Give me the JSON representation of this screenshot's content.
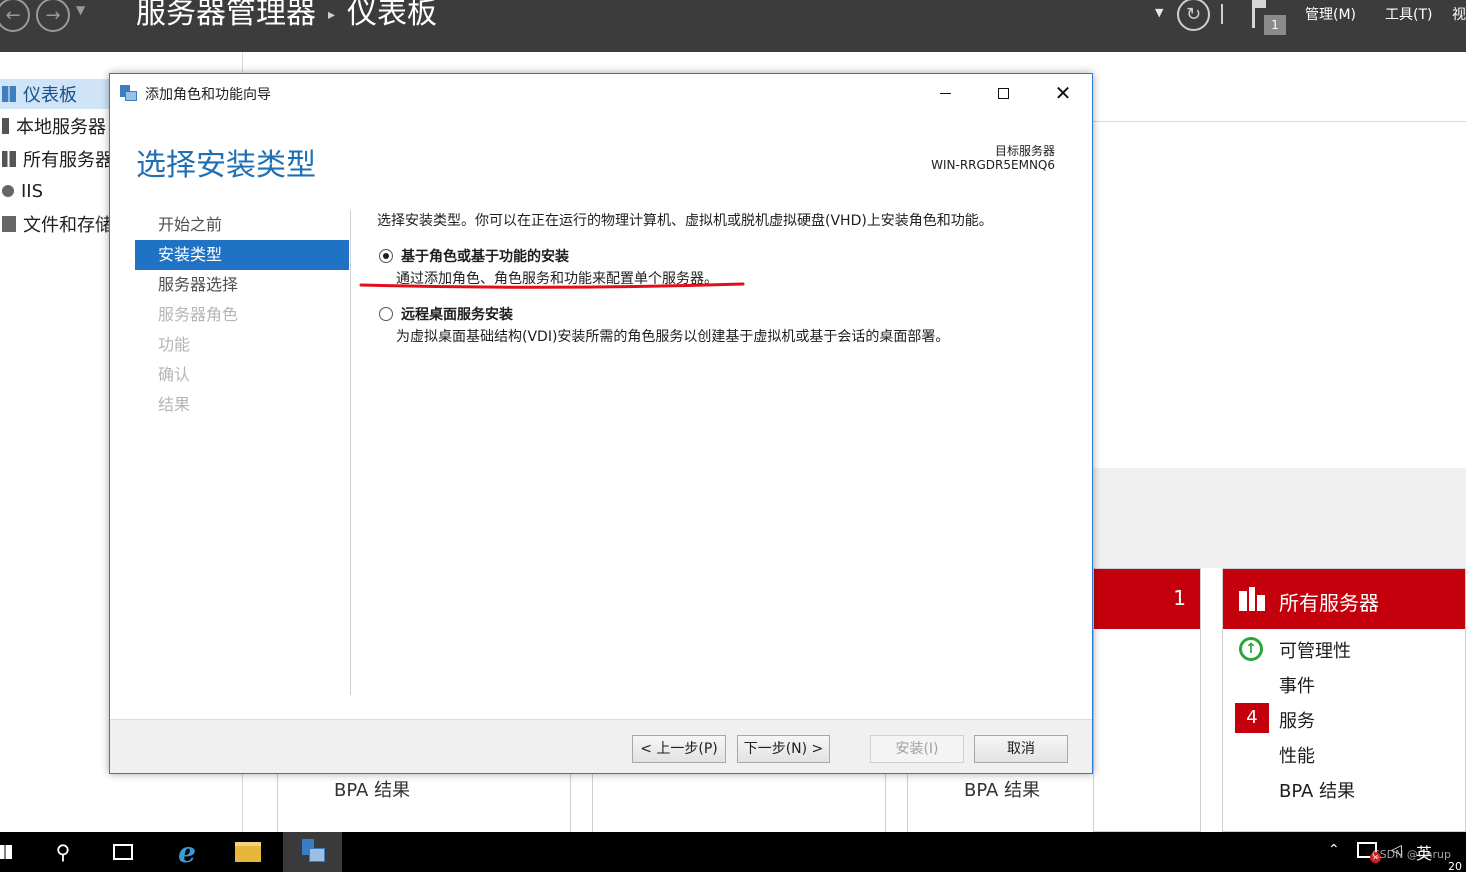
{
  "server_manager": {
    "title": "服务器管理器",
    "breadcrumb_separator": "▸",
    "page": "仪表板",
    "notifications_count": "1",
    "menus": {
      "manage": "管理(M)",
      "tools": "工具(T)",
      "view": "视"
    }
  },
  "leftnav": {
    "items": [
      {
        "label": "仪表板",
        "icon": "dashboard-icon",
        "selected": true
      },
      {
        "label": "本地服务器",
        "icon": "server-icon"
      },
      {
        "label": "所有服务器",
        "icon": "servers-icon"
      },
      {
        "label": "IIS",
        "icon": "iis-icon"
      },
      {
        "label": "文件和存储",
        "icon": "storage-icon"
      }
    ]
  },
  "dashboard": {
    "local_tile_count": "1",
    "all_servers_tile": {
      "title": "所有服务器",
      "rows": {
        "manageability": "可管理性",
        "events": "事件",
        "services": "服务",
        "services_count": "4",
        "performance": "性能",
        "bpa": "BPA 结果"
      }
    },
    "bg_bpa_label": "BPA 结果",
    "colors": {
      "alert": "#c4000c",
      "ok": "#2ea43c"
    }
  },
  "wizard": {
    "window_title": "添加角色和功能向导",
    "heading": "选择安装类型",
    "destination_label": "目标服务器",
    "destination_server": "WIN-RRGDR5EMNQ6",
    "steps": [
      {
        "label": "开始之前",
        "state": "normal"
      },
      {
        "label": "安装类型",
        "state": "active"
      },
      {
        "label": "服务器选择",
        "state": "normal"
      },
      {
        "label": "服务器角色",
        "state": "disabled"
      },
      {
        "label": "功能",
        "state": "disabled"
      },
      {
        "label": "确认",
        "state": "disabled"
      },
      {
        "label": "结果",
        "state": "disabled"
      }
    ],
    "description": "选择安装类型。你可以在正在运行的物理计算机、虚拟机或脱机虚拟硬盘(VHD)上安装角色和功能。",
    "options": [
      {
        "title": "基于角色或基于功能的安装",
        "desc": "通过添加角色、角色服务和功能来配置单个服务器。",
        "checked": true
      },
      {
        "title": "远程桌面服务安装",
        "desc": "为虚拟桌面基础结构(VDI)安装所需的角色服务以创建基于虚拟机或基于会话的桌面部署。",
        "checked": false
      }
    ],
    "buttons": {
      "prev": "< 上一步(P)",
      "next": "下一步(N) >",
      "install": "安装(I)",
      "cancel": "取消"
    },
    "colors": {
      "accent": "#1f72c4",
      "heading": "#1f6fb5",
      "annotation": "#e0101a"
    }
  },
  "taskbar": {
    "ime": "英",
    "clock": "20",
    "watermark": "CSDN @Chrup"
  }
}
